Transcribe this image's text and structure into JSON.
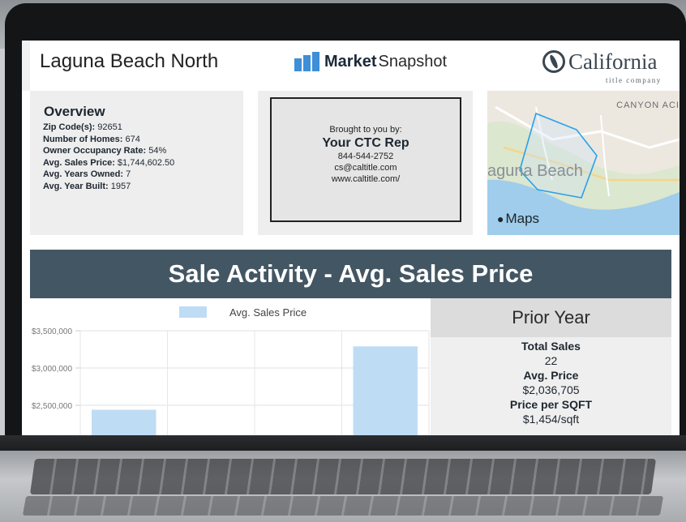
{
  "header": {
    "location": "Laguna Beach North",
    "brand_bold": "Market",
    "brand_light": "Snapshot",
    "company_name": "California",
    "company_sub": "title company"
  },
  "overview": {
    "title": "Overview",
    "rows": [
      {
        "label": "Zip Code(s):",
        "value": "92651"
      },
      {
        "label": "Number of Homes:",
        "value": "674"
      },
      {
        "label": "Owner Occupancy Rate:",
        "value": "54%"
      },
      {
        "label": "Avg. Sales Price:",
        "value": "$1,744,602.50"
      },
      {
        "label": "Avg. Years Owned:",
        "value": "7"
      },
      {
        "label": "Avg. Year Built:",
        "value": "1957"
      }
    ]
  },
  "contact": {
    "brought_by": "Brought to you by:",
    "rep_name": "Your CTC Rep",
    "phone": "844-544-2752",
    "email": "cs@caltitle.com",
    "website": "www.caltitle.com/"
  },
  "map": {
    "area_label": "aguna Beach",
    "corner_label": "CANYON ACI",
    "provider": "Maps"
  },
  "section": {
    "title": "Sale Activity - Avg. Sales Price"
  },
  "chart_data": {
    "type": "bar",
    "legend": "Avg. Sales Price",
    "y_ticks": [
      "$3,500,000",
      "$3,000,000",
      "$2,500,000"
    ],
    "ylim": [
      2000000,
      3500000
    ],
    "categories": [
      "",
      "",
      "",
      ""
    ],
    "values": [
      2440000,
      null,
      null,
      3290000
    ],
    "color": "#bfdcf5"
  },
  "prior_year": {
    "title": "Prior Year",
    "stats": [
      {
        "label": "Total Sales",
        "value": "22"
      },
      {
        "label": "Avg. Price",
        "value": "$2,036,705"
      },
      {
        "label": "Price per SQFT",
        "value": "$1,454/sqft"
      }
    ]
  },
  "colors": {
    "band": "#435663",
    "accent": "#3d8fd8",
    "bar": "#bfdcf5"
  }
}
